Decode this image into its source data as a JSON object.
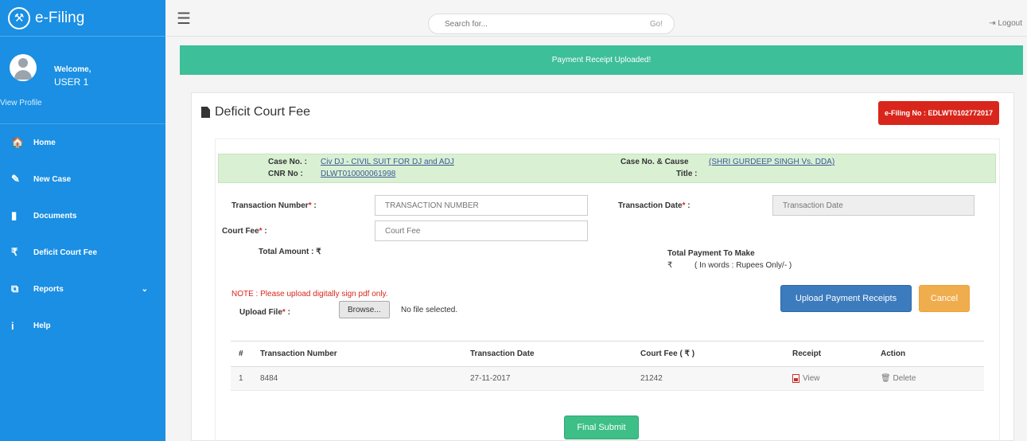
{
  "app": {
    "title": "e-Filing",
    "logo_icon": "gavel-icon"
  },
  "sidebar": {
    "welcome": "Welcome,",
    "username": "USER 1",
    "view_profile": "View Profile",
    "items": [
      {
        "label": "Home",
        "icon": "home-icon",
        "glyph": "🏠"
      },
      {
        "label": "New Case",
        "icon": "edit-icon",
        "glyph": "✎"
      },
      {
        "label": "Documents",
        "icon": "document-icon",
        "glyph": "▮"
      },
      {
        "label": "Deficit Court Fee",
        "icon": "rupee-icon",
        "glyph": "₹"
      },
      {
        "label": "Reports",
        "icon": "copy-icon",
        "glyph": "⧉"
      },
      {
        "label": "Help",
        "icon": "info-icon",
        "glyph": "i"
      }
    ],
    "bg_color": "#1a8fe3"
  },
  "topbar": {
    "search_placeholder": "Search for...",
    "go_label": "Go!",
    "logout_label": "Logout"
  },
  "alert": {
    "message": "Payment Receipt Uploaded!",
    "color": "#3dbf99"
  },
  "panel": {
    "title": "Deficit Court Fee",
    "efiling_no": "e-Filing No : EDLWT0102772017"
  },
  "case_info": {
    "case_no_label": "Case No. :",
    "case_no_value": "Civ DJ - CIVIL SUIT FOR DJ and ADJ",
    "cnr_label": "CNR No :",
    "cnr_value": "DLWT010000061998",
    "cause_label": "Case No. & Cause",
    "cause_value": "(SHRI GURDEEP SINGH Vs. DDA)",
    "title_label": "Title :"
  },
  "form": {
    "txn_number_label": "Transaction Number",
    "txn_number_placeholder": "TRANSACTION NUMBER",
    "txn_date_label": "Transaction Date",
    "txn_date_placeholder": "Transaction Date",
    "court_fee_label": "Court Fee",
    "court_fee_placeholder": "Court Fee",
    "required_mark": "*",
    "colon": " :",
    "total_amount": "Total Amount : ₹",
    "total_payment_label": "Total Payment To Make",
    "rupee": "₹",
    "in_words": "( In words : Rupees Only/- )",
    "note": "NOTE : Please upload digitally sign pdf only.",
    "upload_label": "Upload File",
    "browse_label": "Browse...",
    "no_file": "No file selected.",
    "upload_button": "Upload Payment Receipts",
    "cancel_button": "Cancel"
  },
  "table": {
    "headers": [
      "#",
      "Transaction Number",
      "Transaction Date",
      "Court Fee ( ₹ )",
      "Receipt",
      "Action"
    ],
    "rows": [
      {
        "index": "1",
        "txn_number": "8484",
        "txn_date": "27-11-2017",
        "court_fee": "21242",
        "receipt": "View",
        "action": "Delete"
      }
    ]
  },
  "final_submit": "Final Submit"
}
